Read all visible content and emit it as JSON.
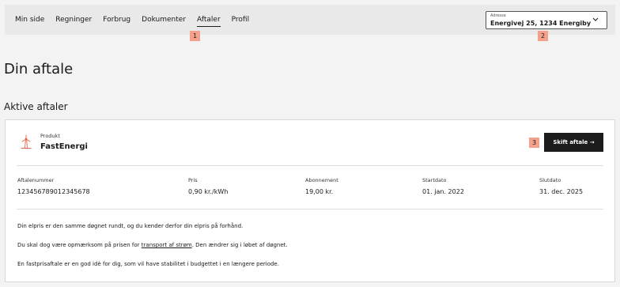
{
  "nav": {
    "items": [
      {
        "label": "Min side"
      },
      {
        "label": "Regninger"
      },
      {
        "label": "Forbrug"
      },
      {
        "label": "Dokumenter"
      },
      {
        "label": "Aftaler"
      },
      {
        "label": "Profil"
      }
    ],
    "active": "Aftaler"
  },
  "address": {
    "label": "Adresse",
    "value": "Energivej 25, 1234 Energiby",
    "icon": "chevron-down-icon"
  },
  "markers": [
    "1",
    "2",
    "3"
  ],
  "page": {
    "title": "Din aftale",
    "section_title": "Aktive aftaler"
  },
  "product": {
    "label": "Produkt",
    "name": "FastEnergi",
    "icon": "wind-turbine-icon",
    "icon_color": "#e8664a"
  },
  "switch_button": {
    "label": "Skift aftale →"
  },
  "details": [
    {
      "key": "Aftalenummer",
      "value": "123456789012345678"
    },
    {
      "key": "Pris",
      "value": "0,90 kr./kWh"
    },
    {
      "key": "Abonnement",
      "value": "19,00 kr."
    },
    {
      "key": "Startdato",
      "value": "01. jan. 2022"
    },
    {
      "key": "Slutdato",
      "value": "31. dec. 2025"
    }
  ],
  "paragraphs": {
    "p1": "Din elpris er den samme døgnet rundt, og du kender derfor din elpris på forhånd.",
    "p2_before": "Du skal dog være opmærksom på prisen for ",
    "p2_link": "transport af strøm",
    "p2_after": ". Den ændrer sig i løbet af døgnet.",
    "p3": "En fastprisaftale er en god idè for dig, som vil have stabilitet i budgettet i en længere periode."
  }
}
